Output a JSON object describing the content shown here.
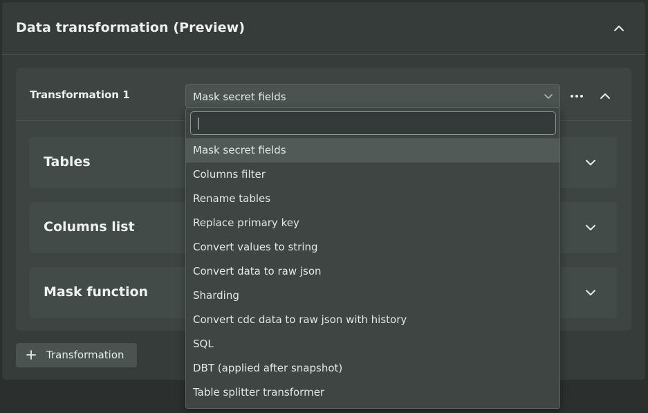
{
  "panel": {
    "title": "Data transformation (Preview)"
  },
  "transformation": {
    "title": "Transformation 1",
    "selected": "Mask secret fields"
  },
  "sections": [
    {
      "label": "Tables"
    },
    {
      "label": "Columns list"
    },
    {
      "label": "Mask function"
    }
  ],
  "add_button": {
    "label": "Transformation"
  },
  "dropdown": {
    "search_value": "",
    "options": [
      "Mask secret fields",
      "Columns filter",
      "Rename tables",
      "Replace primary key",
      "Convert values to string",
      "Convert data to raw json",
      "Sharding",
      "Convert cdc data to raw json with history",
      "SQL",
      "DBT (applied after snapshot)",
      "Table splitter transformer"
    ],
    "selected_index": 0
  },
  "icons": {
    "collapse": "chevron-up-icon",
    "expand": "chevron-down-icon",
    "more": "more-horizontal-icon",
    "add": "plus-icon"
  },
  "colors": {
    "background": "#2b2f2e",
    "panel": "#353c3a",
    "card": "#3d4442",
    "highlight": "#515a57",
    "text": "#e8ecea"
  }
}
